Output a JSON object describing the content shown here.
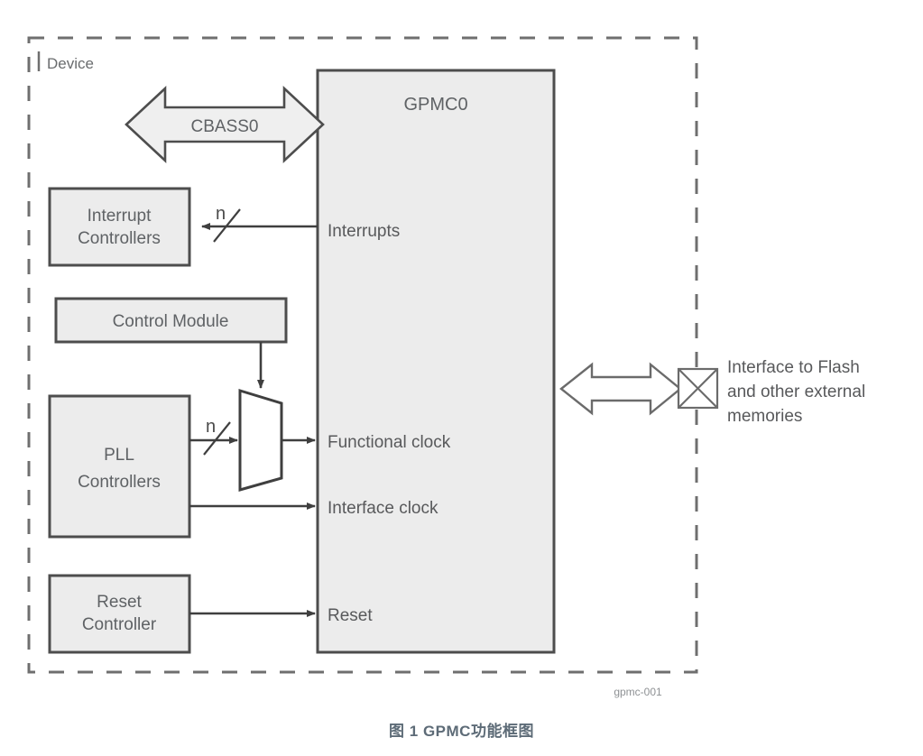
{
  "figure": {
    "boundary_label": "Device",
    "figure_id": "gpmc-001",
    "caption": "图 1 GPMC功能框图"
  },
  "colors": {
    "block_fill": "#ececec",
    "block_stroke": "#4d4d4d",
    "line": "#3f3f3f",
    "dashed_boundary": "#6f6f6f",
    "text": "#58595b",
    "caption": "#5d6b77",
    "arrow_fill": "#efefef"
  },
  "main_block": {
    "title": "GPMC0",
    "ports": [
      {
        "id": "interrupts",
        "label": "Interrupts"
      },
      {
        "id": "functional-clock",
        "label": "Functional clock"
      },
      {
        "id": "interface-clock",
        "label": "Interface clock"
      },
      {
        "id": "reset",
        "label": "Reset"
      }
    ]
  },
  "bus": {
    "label": "CBASS0"
  },
  "left_blocks": [
    {
      "id": "interrupt-controllers",
      "lines": [
        "Interrupt",
        "Controllers"
      ]
    },
    {
      "id": "control-module",
      "lines": [
        "Control Module"
      ]
    },
    {
      "id": "pll-controllers",
      "lines": [
        "PLL",
        "Controllers"
      ]
    },
    {
      "id": "reset-controller",
      "lines": [
        "Reset",
        "Controller"
      ]
    }
  ],
  "mux": {
    "id": "clock-mux",
    "label": ""
  },
  "bus_width_labels": {
    "interrupts": "n",
    "pll_functional": "n"
  },
  "external": {
    "lines": [
      "Interface to Flash",
      "and other external",
      "memories"
    ]
  }
}
